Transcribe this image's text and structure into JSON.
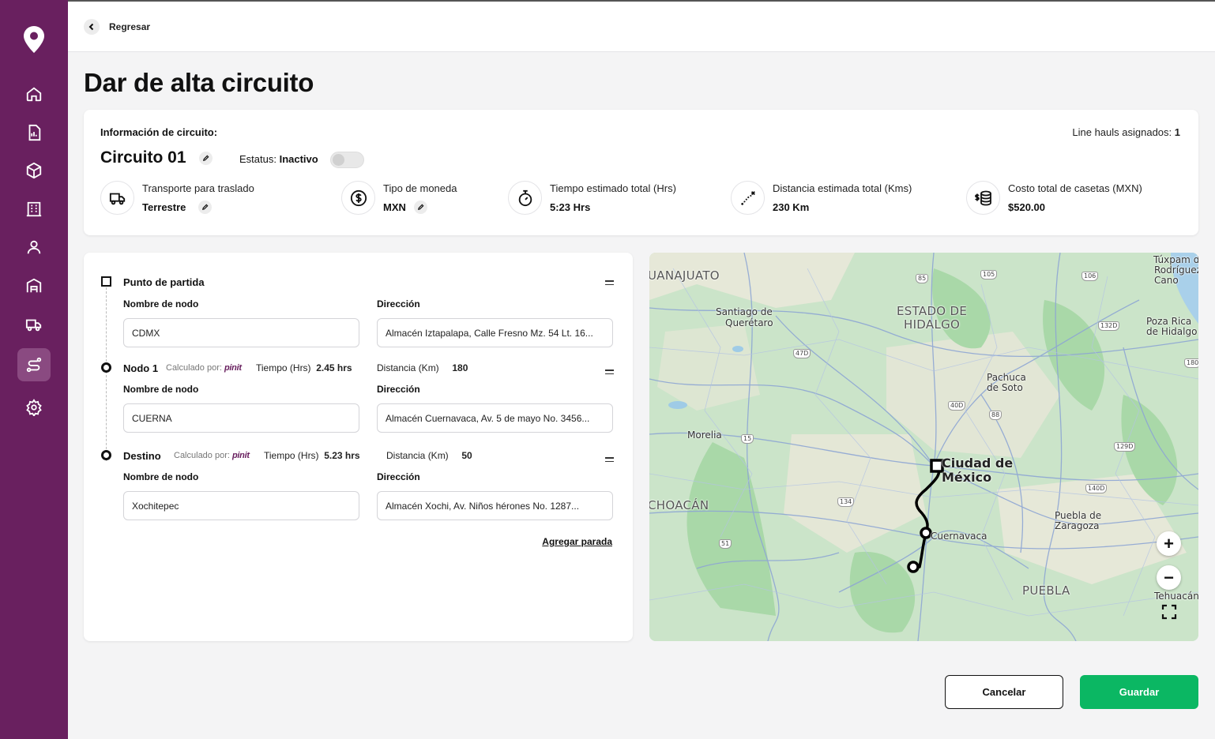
{
  "sidebar": {
    "icons": [
      "location-pin-icon",
      "home-icon",
      "document-icon",
      "box-icon",
      "building-icon",
      "user-icon",
      "warehouse-icon",
      "truck-icon",
      "route-icon",
      "gear-icon"
    ],
    "accent": "#69205f"
  },
  "topbar": {
    "back_label": "Regresar"
  },
  "page": {
    "title": "Dar de alta circuito"
  },
  "info": {
    "heading": "Información de circuito:",
    "linehauls_label": "Line hauls asignados:",
    "linehauls_value": "1",
    "circuit_name": "Circuito 01",
    "status_label": "Estatus:",
    "status_value": "Inactivo",
    "metrics": [
      {
        "icon": "truck-icon",
        "label": "Transporte para traslado",
        "value": "Terrestre"
      },
      {
        "icon": "dollar-icon",
        "label": "Tipo de moneda",
        "value": "MXN"
      },
      {
        "icon": "stopwatch-icon",
        "label": "Tiempo estimado total (Hrs)",
        "value": "5:23 Hrs"
      },
      {
        "icon": "route-distance-icon",
        "label": "Distancia estimada total (Kms)",
        "value": "230 Km"
      },
      {
        "icon": "coins-icon",
        "label": "Costo total de casetas (MXN)",
        "value": "$520.00"
      }
    ]
  },
  "route": {
    "node_name_label": "Nombre de nodo",
    "address_label": "Dirección",
    "calculated_by": "Calculado por:",
    "brand": "pinit",
    "time_label": "Tiempo (Hrs)",
    "distance_label": "Distancia (Km)",
    "nodes": [
      {
        "title": "Punto de partida",
        "name": "CDMX",
        "address": "Almacén Iztapalapa, Calle Fresno Mz. 54 Lt. 16..."
      },
      {
        "title": "Nodo 1",
        "time": "2.45 hrs",
        "distance": "180",
        "name": "CUERNA",
        "address": "Almacén Cuernavaca, Av. 5 de mayo  No. 3456..."
      },
      {
        "title": "Destino",
        "time": "5.23 hrs",
        "distance": "50",
        "name": "Xochitepec",
        "address": "Almacén Xochi, Av. Niños hérones  No. 1287..."
      }
    ],
    "add_stop": "Agregar parada"
  },
  "map": {
    "labels": {
      "guanajuato": "UANAJUATO",
      "queretaro_1": "Santiago de",
      "queretaro_2": "Querétaro",
      "hidalgo_1": "ESTADO DE",
      "hidalgo_2": "HIDALGO",
      "tuxpam_1": "Túxpam d",
      "tuxpam_2": "Rodríguez",
      "tuxpam_3": "Cano",
      "pozarica_1": "Poza Rica",
      "pozarica_2": "de Hidalgo",
      "pachuca_1": "Pachuca",
      "pachuca_2": "de Soto",
      "morelia": "Morelia",
      "cdmx_1": "Ciudad de",
      "cdmx_2": "México",
      "michoacan": "CHOACÁN",
      "puebla_city_1": "Puebla de",
      "puebla_city_2": "Zaragoza",
      "cuernavaca": "Cuernavaca",
      "puebla_state": "PUEBLA",
      "tehuacan": "Tehuacán"
    },
    "highways": [
      "85",
      "105",
      "106",
      "132D",
      "180",
      "47D",
      "40D",
      "88",
      "129D",
      "15",
      "140D",
      "134",
      "51"
    ],
    "controls": {
      "zoom_in": "+",
      "zoom_out": "−"
    }
  },
  "actions": {
    "cancel": "Cancelar",
    "save": "Guardar",
    "save_color": "#0bb763"
  }
}
